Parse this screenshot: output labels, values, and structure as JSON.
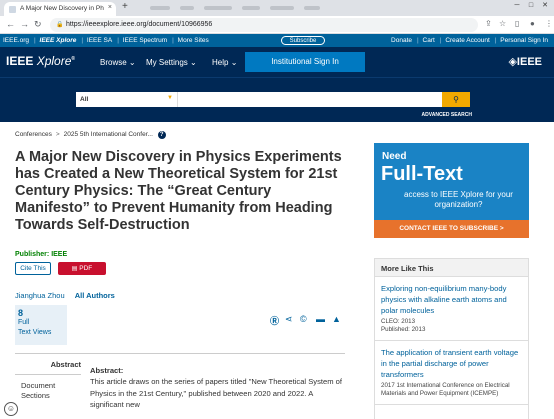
{
  "browser": {
    "tab_title": "A Major New Discovery in Ph",
    "tab_close": "×",
    "new_tab": "+",
    "url": "https://ieeexplore.ieee.org/document/10966956"
  },
  "top_links": {
    "left": [
      "IEEE.org",
      "IEEE Xplore",
      "IEEE SA",
      "IEEE Spectrum",
      "More Sites"
    ],
    "subscribe": "Subscribe",
    "right": [
      "Donate",
      "Cart",
      "Create Account",
      "Personal Sign In"
    ]
  },
  "header": {
    "logo_main": "IEEE",
    "logo_sub": "Xplore",
    "menus": [
      "Browse",
      "My Settings",
      "Help"
    ],
    "institutional_sign_in": "Institutional Sign In",
    "ieee_logo": "IEEE"
  },
  "search": {
    "scope": "All",
    "advanced": "ADVANCED SEARCH"
  },
  "breadcrumb": [
    "Conferences",
    "2025 5th International Confer..."
  ],
  "article": {
    "title": "A Major New Discovery in Physics Experiments has Created a New Theoretical System for 21st Century Physics: The “Great Century Manifesto” to Prevent Humanity from Heading Towards Self-Destruction",
    "publisher_label": "Publisher:",
    "publisher": "IEEE",
    "cite_button": "Cite This",
    "pdf_button": "PDF",
    "author": "Jianghua Zhou",
    "all_authors": "All Authors",
    "views_count": "8",
    "views_label_1": "Full",
    "views_label_2": "Text Views"
  },
  "abstract_nav": {
    "active": "Abstract",
    "items": [
      "Document",
      "Sections"
    ]
  },
  "abstract": {
    "heading": "Abstract:",
    "text": "This article draws on the series of papers titled \"New Theoretical System of Physics in the 21st Century,\" published between 2020 and 2022. A significant new"
  },
  "ad": {
    "need": "Need",
    "full_text": "Full-Text",
    "access": "access to IEEE Xplore for your organization?",
    "cta": "CONTACT IEEE TO SUBSCRIBE >"
  },
  "more_like_this": {
    "heading": "More Like This",
    "items": [
      {
        "title": "Exploring non-equilibrium many-body physics with alkaline earth atoms and polar molecules",
        "meta1": "CLEO: 2013",
        "meta2": "Published: 2013"
      },
      {
        "title": "The application of transient earth voltage in the partial discharge of power transformers",
        "meta1": "2017 1st International Conference on Electrical Materials and Power Equipment (ICEMPE)",
        "meta2": ""
      }
    ]
  }
}
